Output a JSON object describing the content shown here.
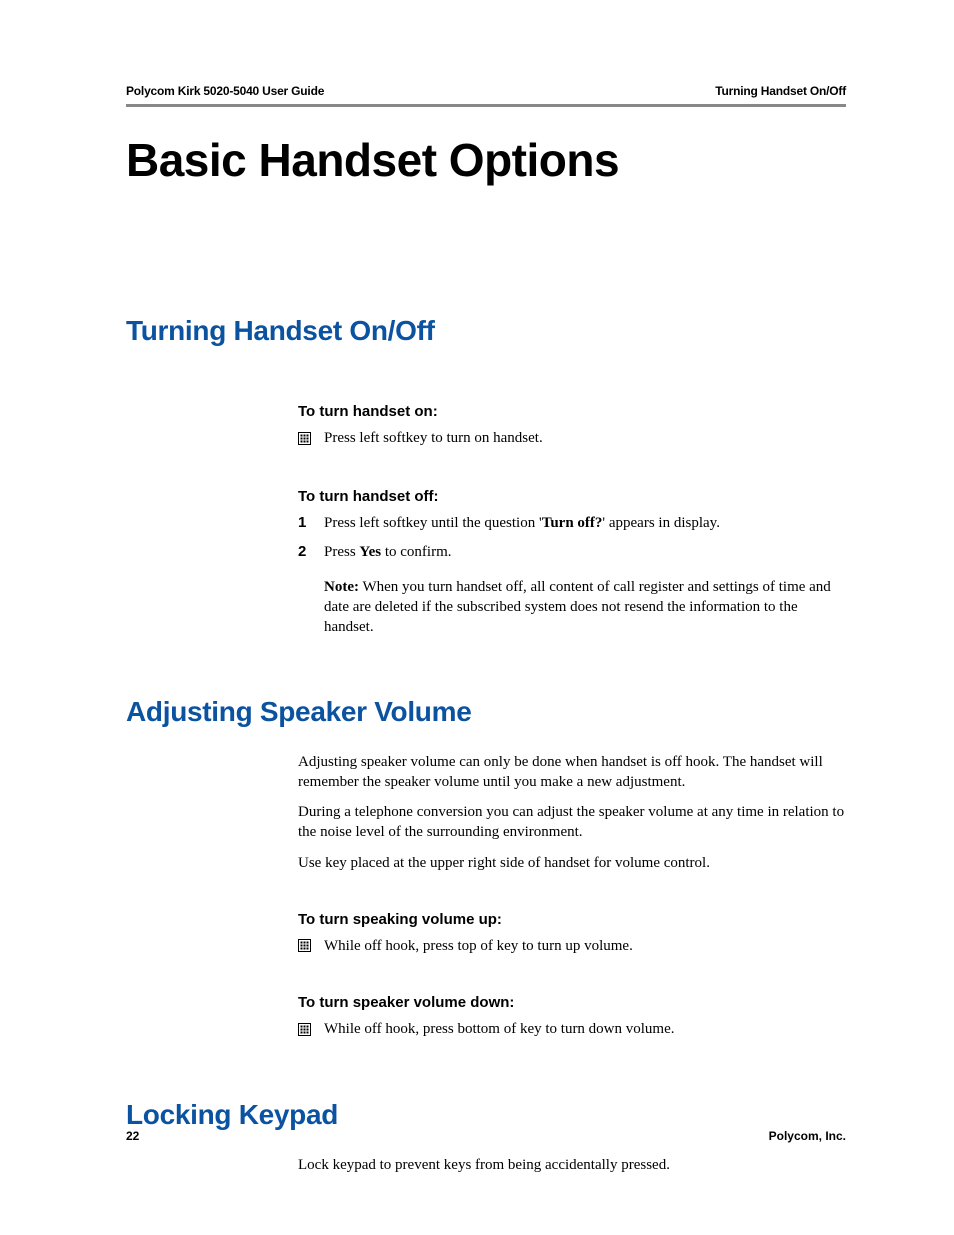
{
  "header": {
    "left": "Polycom Kirk 5020-5040 User Guide",
    "right": "Turning Handset On/Off"
  },
  "title": "Basic Handset Options",
  "sections": {
    "turning": {
      "heading": "Turning Handset On/Off",
      "on_heading": "To turn handset on:",
      "on_step": "Press left softkey to turn on handset.",
      "off_heading": "To turn handset off:",
      "off_step1_pre": "Press left softkey until the question '",
      "off_step1_bold": "Turn off?",
      "off_step1_post": "' appears in display.",
      "off_step2_pre": "Press ",
      "off_step2_bold": "Yes",
      "off_step2_post": " to confirm.",
      "note_label": "Note:",
      "note_body": " When you turn handset off, all content of call register and settings of time and date are deleted if the subscribed system does not resend the information to the handset."
    },
    "volume": {
      "heading": "Adjusting Speaker Volume",
      "p1": "Adjusting speaker volume can only be done when handset is off hook. The handset will remember the speaker volume until you make a new adjustment.",
      "p2": "During a telephone conversion you can adjust the speaker volume at any time in relation to the noise level of the surrounding environment.",
      "p3": "Use key placed at the upper right side of handset for volume control.",
      "up_heading": "To turn speaking volume up:",
      "up_step": "While off hook, press top of key to turn up volume.",
      "down_heading": "To turn speaker volume down:",
      "down_step": "While off hook, press bottom of key to turn down volume."
    },
    "locking": {
      "heading": "Locking Keypad",
      "p1": "Lock keypad to prevent keys from being accidentally pressed."
    }
  },
  "footer": {
    "page": "22",
    "company": "Polycom, Inc."
  },
  "numbers": {
    "one": "1",
    "two": "2"
  }
}
